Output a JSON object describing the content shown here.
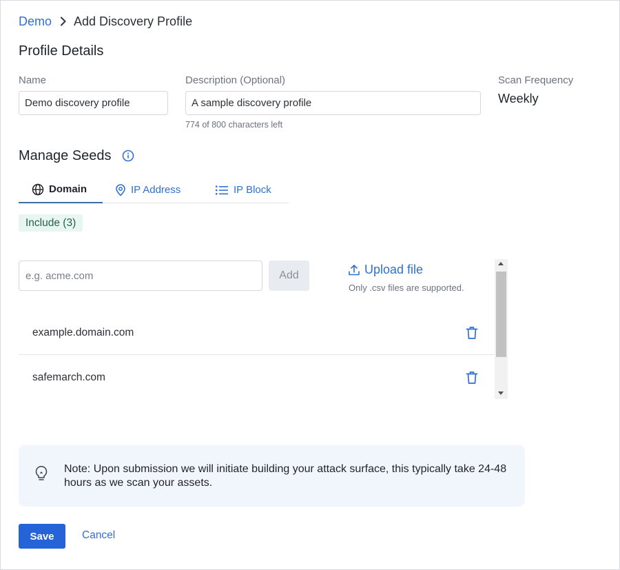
{
  "breadcrumb": {
    "parent": "Demo",
    "current": "Add Discovery Profile"
  },
  "profile_details": {
    "title": "Profile Details",
    "name_label": "Name",
    "name_value": "Demo discovery profile",
    "description_label": "Description (Optional)",
    "description_value": "A sample discovery profile",
    "characters_left": "774 of 800 characters left",
    "frequency_label": "Scan Frequency",
    "frequency_value": "Weekly"
  },
  "manage_seeds": {
    "title": "Manage Seeds",
    "tabs": [
      {
        "label": "Domain",
        "icon": "globe-icon",
        "active": true
      },
      {
        "label": "IP Address",
        "icon": "location-pin-icon",
        "active": false
      },
      {
        "label": "IP Block",
        "icon": "list-icon",
        "active": false
      }
    ],
    "include_badge": "Include (3)",
    "seed_placeholder": "e.g. acme.com",
    "add_label": "Add",
    "upload_label": "Upload file",
    "upload_hint": "Only .csv files are supported.",
    "seeds": [
      {
        "value": "example.domain.com"
      },
      {
        "value": "safemarch.com"
      }
    ]
  },
  "note": {
    "text": "Note: Upon submission we will initiate building your attack surface, this typically take 24-48 hours as we scan your assets."
  },
  "actions": {
    "save_label": "Save",
    "cancel_label": "Cancel"
  },
  "colors": {
    "primary": "#2563d9",
    "link": "#2f6fd3",
    "include_bg": "#e7f6f1",
    "note_bg": "#f1f6fd"
  }
}
